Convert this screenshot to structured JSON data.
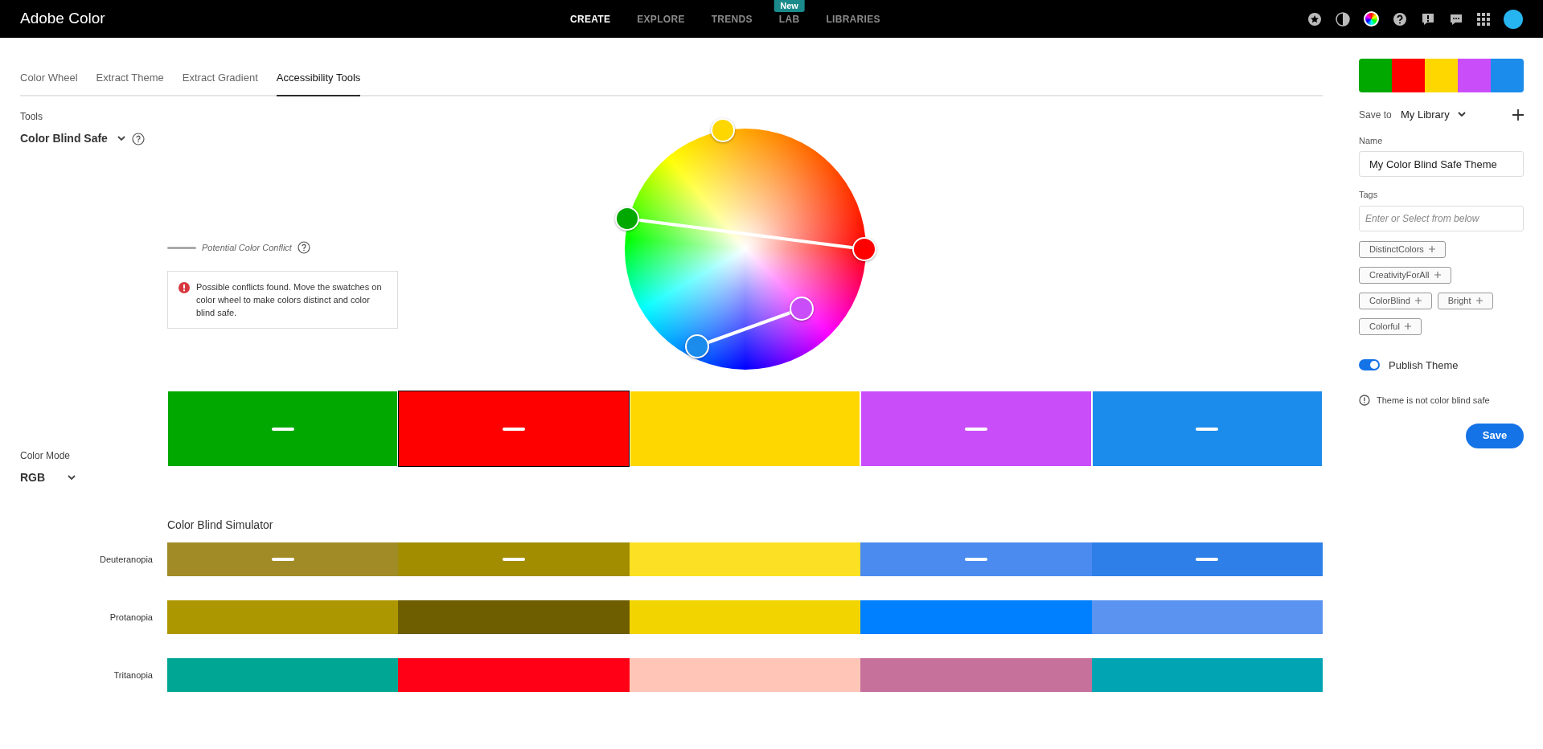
{
  "app": {
    "title": "Adobe Color"
  },
  "nav": [
    {
      "label": "CREATE",
      "selected": true
    },
    {
      "label": "EXPLORE",
      "selected": false
    },
    {
      "label": "TRENDS",
      "selected": false
    },
    {
      "label": "LAB",
      "selected": false,
      "badge": "New"
    },
    {
      "label": "LIBRARIES",
      "selected": false
    }
  ],
  "tabs": [
    {
      "label": "Color Wheel",
      "selected": false
    },
    {
      "label": "Extract Theme",
      "selected": false
    },
    {
      "label": "Extract Gradient",
      "selected": false
    },
    {
      "label": "Accessibility Tools",
      "selected": true
    }
  ],
  "tools": {
    "label": "Tools",
    "value": "Color Blind Safe"
  },
  "legend": {
    "label": "Potential Color Conflict"
  },
  "alert": {
    "text": "Possible conflicts found. Move the swatches on color wheel to make colors distinct and color blind safe."
  },
  "swatches": [
    {
      "color": "#00a800",
      "conflict": true,
      "selected": false
    },
    {
      "color": "#ff0000",
      "conflict": true,
      "selected": true
    },
    {
      "color": "#ffd700",
      "conflict": false,
      "selected": false
    },
    {
      "color": "#c94ef9",
      "conflict": true,
      "selected": false
    },
    {
      "color": "#1b8ceb",
      "conflict": true,
      "selected": false
    }
  ],
  "color_mode": {
    "label": "Color Mode",
    "value": "RGB"
  },
  "simulator": {
    "title": "Color Blind Simulator",
    "rows": [
      {
        "label": "Deuteranopia",
        "cells": [
          {
            "color": "#a18b26",
            "conflict": true
          },
          {
            "color": "#a28c00",
            "conflict": true
          },
          {
            "color": "#fce024",
            "conflict": false
          },
          {
            "color": "#4b8bf0",
            "conflict": true
          },
          {
            "color": "#2f7fe8",
            "conflict": true
          }
        ]
      },
      {
        "label": "Protanopia",
        "cells": [
          {
            "color": "#ad9700",
            "conflict": false
          },
          {
            "color": "#6e5e00",
            "conflict": false
          },
          {
            "color": "#f1d400",
            "conflict": false
          },
          {
            "color": "#0080ff",
            "conflict": false
          },
          {
            "color": "#5a93f0",
            "conflict": false
          }
        ]
      },
      {
        "label": "Tritanopia",
        "cells": [
          {
            "color": "#00a694",
            "conflict": false
          },
          {
            "color": "#ff0016",
            "conflict": false
          },
          {
            "color": "#ffc6b8",
            "conflict": false
          },
          {
            "color": "#c6709c",
            "conflict": false
          },
          {
            "color": "#00a4b2",
            "conflict": false
          }
        ]
      }
    ]
  },
  "panel": {
    "preview": [
      {
        "color": "#00a800"
      },
      {
        "color": "#ff0000"
      },
      {
        "color": "#ffd700"
      },
      {
        "color": "#c94ef9"
      },
      {
        "color": "#1b8ceb"
      }
    ],
    "save_to_label": "Save to",
    "library": "My Library",
    "name_label": "Name",
    "name_value": "My Color Blind Safe Theme",
    "tags_label": "Tags",
    "tags_placeholder": "Enter or Select from below",
    "tag_suggestions": [
      "DistinctColors",
      "CreativityForAll",
      "ColorBlind",
      "Bright",
      "Colorful"
    ],
    "publish": {
      "label": "Publish Theme",
      "on": true
    },
    "warning": "Theme is not color blind safe",
    "save": "Save"
  }
}
